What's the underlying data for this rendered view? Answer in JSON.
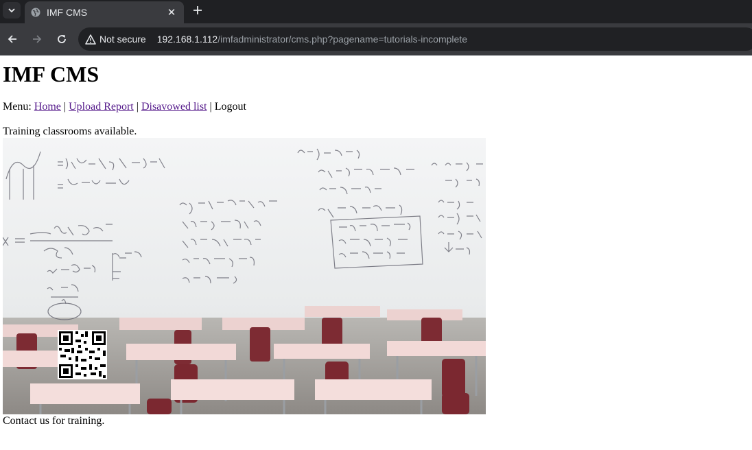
{
  "browser": {
    "tab_title": "IMF CMS",
    "security_label": "Not secure",
    "url_host": "192.168.1.112",
    "url_path": "/imfadministrator/cms.php?pagename=tutorials-incomplete"
  },
  "page": {
    "heading": "IMF CMS",
    "menu_prefix": "Menu:",
    "menu_items": [
      {
        "label": "Home",
        "link": true
      },
      {
        "label": "Upload Report",
        "link": true
      },
      {
        "label": "Disavowed list",
        "link": true
      },
      {
        "label": "Logout",
        "link": false
      }
    ],
    "separator": "|",
    "intro_text": "Training classrooms available.",
    "outro_text": "Contact us for training."
  },
  "colors": {
    "chrome_dark": "#1f2023",
    "toolbar": "#3a3b3f",
    "visited_link": "#551a8b"
  },
  "icons": [
    "tab-list-icon",
    "globe-favicon-icon",
    "close-icon",
    "plus-icon",
    "back-arrow-icon",
    "forward-arrow-icon",
    "reload-icon",
    "warning-icon",
    "qr-code-icon"
  ]
}
